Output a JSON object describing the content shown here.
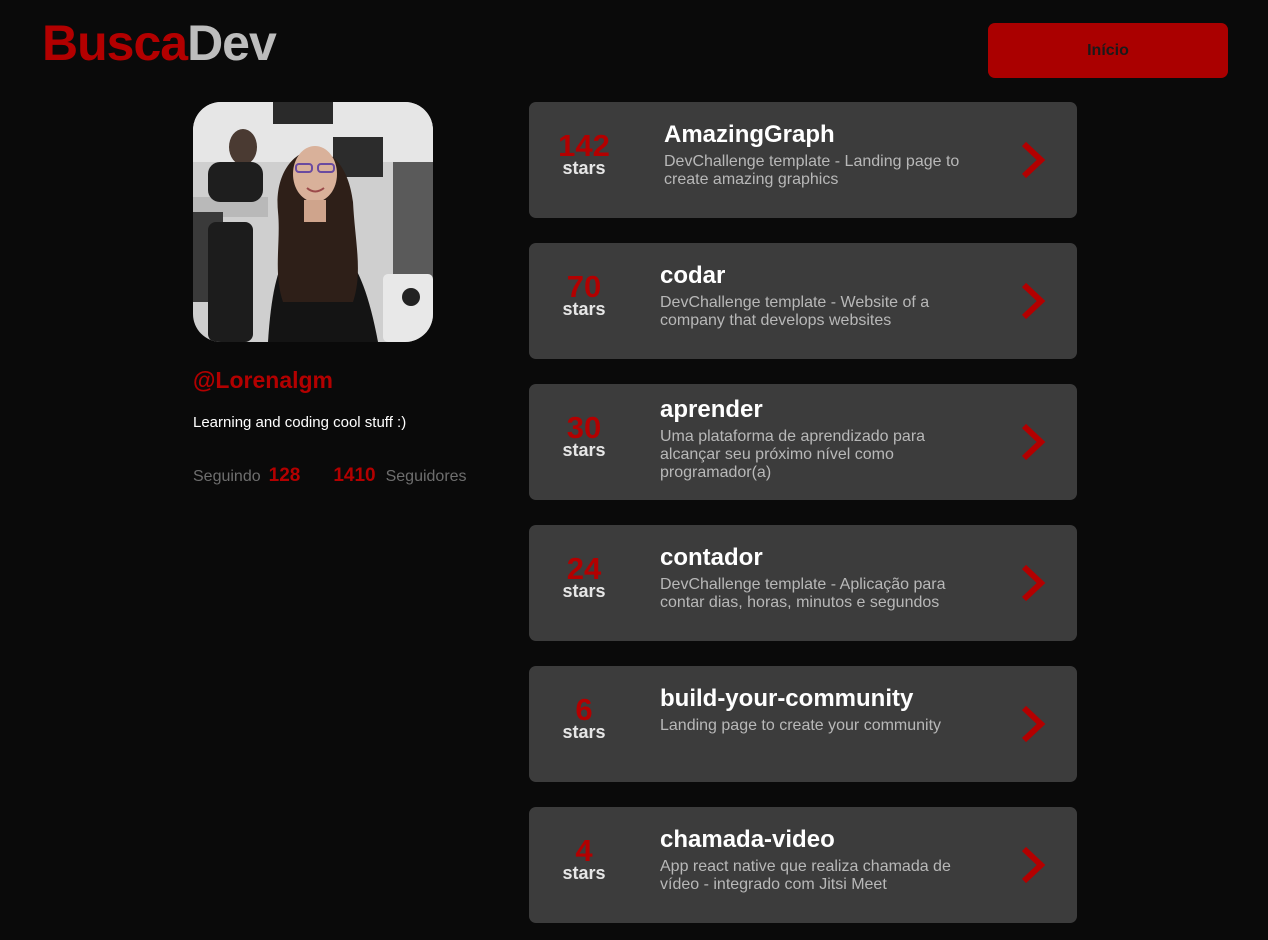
{
  "header": {
    "logo_part1": "Busca",
    "logo_part2": "Dev",
    "home_button": "Início"
  },
  "profile": {
    "username": "@Lorenalgm",
    "bio": "Learning and coding cool stuff :)",
    "following_label": "Seguindo",
    "following_count": "128",
    "followers_count": "1410",
    "followers_label": "Seguidores"
  },
  "repos": [
    {
      "stars": "142",
      "stars_label": "stars",
      "name": "AmazingGraph",
      "description": "DevChallenge template - Landing page to create amazing graphics"
    },
    {
      "stars": "70",
      "stars_label": "stars",
      "name": "codar",
      "description": "DevChallenge template - Website of a company that develops websites"
    },
    {
      "stars": "30",
      "stars_label": "stars",
      "name": "aprender",
      "description": "Uma plataforma de aprendizado para alcançar seu próximo nível como programador(a)"
    },
    {
      "stars": "24",
      "stars_label": "stars",
      "name": "contador",
      "description": "DevChallenge template - Aplicação para contar dias, horas, minutos e segundos"
    },
    {
      "stars": "6",
      "stars_label": "stars",
      "name": "build-your-community",
      "description": "Landing page to create your community"
    },
    {
      "stars": "4",
      "stars_label": "stars",
      "name": "chamada-video",
      "description": "App react native que realiza chamada de vídeo - integrado com Jitsi Meet"
    }
  ],
  "colors": {
    "background": "#0a0a0a",
    "accent": "#b30000",
    "card": "#3c3c3c"
  }
}
